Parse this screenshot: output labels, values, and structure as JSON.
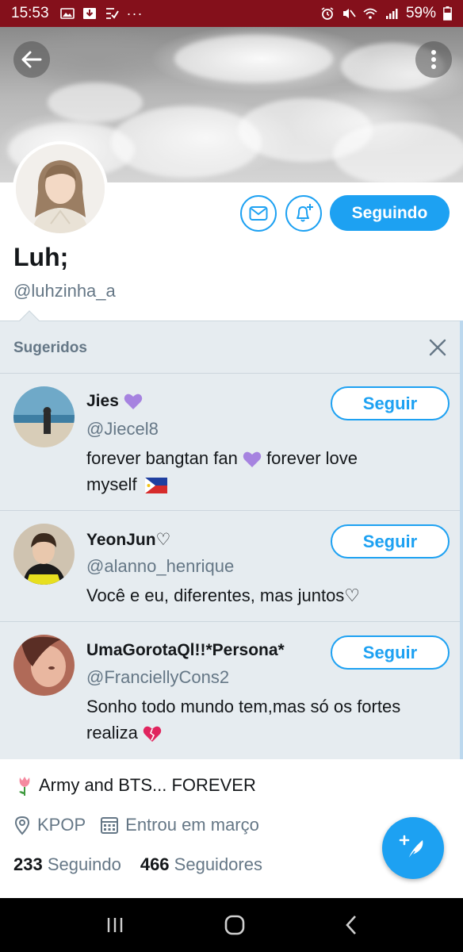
{
  "status_bar": {
    "time": "15:53",
    "battery": "59%"
  },
  "profile": {
    "follow_button": "Seguindo",
    "display_name": "Luh;",
    "handle": "@luhzinha_a",
    "bio": "Army and BTS... FOREVER",
    "location": "KPOP",
    "joined": "Entrou em março",
    "following_count": "233",
    "following_label": "Seguindo",
    "followers_count": "466",
    "followers_label": "Seguidores"
  },
  "suggestions": {
    "title": "Sugeridos",
    "items": [
      {
        "name": "Jies",
        "handle": "@Jiecel8",
        "bio_line1": "forever bangtan fan",
        "bio_line1b": "forever love",
        "bio_line2": "myself",
        "follow_label": "Seguir"
      },
      {
        "name": "YeonJun♡",
        "handle": "@alanno_henrique",
        "bio_line1": "Você e eu, diferentes, mas juntos♡",
        "follow_label": "Seguir"
      },
      {
        "name": "UmaGorotaQl!!*Persona*",
        "handle": "@FranciellyCons2",
        "bio_line1": "Sonho todo mundo tem,mas só os fortes",
        "bio_line2": "realiza",
        "follow_label": "Seguir"
      }
    ]
  },
  "colors": {
    "accent": "#1da1f2",
    "status_bar": "#84101b",
    "panel_bg": "#e6ecf0",
    "secondary_text": "#657786",
    "heart_purple": "#a683e0"
  },
  "icons": [
    "back-arrow-icon",
    "overflow-menu-icon",
    "mail-icon",
    "notification-bell-icon",
    "close-icon",
    "location-pin-icon",
    "calendar-icon",
    "compose-tweet-icon",
    "recent-apps-icon",
    "home-icon",
    "back-nav-icon"
  ]
}
